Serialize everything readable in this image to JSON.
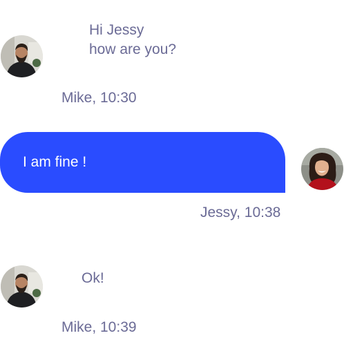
{
  "colors": {
    "accent": "#2a4cff",
    "text_muted": "#6b6b96",
    "bubble_text": "#ffffff"
  },
  "messages": [
    {
      "sender": "Mike",
      "direction": "incoming",
      "lines": [
        "Hi Jessy",
        "how are you?"
      ],
      "meta": "Mike, 10:30",
      "avatar_icon": "avatar-man-beard"
    },
    {
      "sender": "Jessy",
      "direction": "outgoing",
      "lines": [
        "I am fine !"
      ],
      "meta": "Jessy, 10:38",
      "avatar_icon": "avatar-woman-red-top"
    },
    {
      "sender": "Mike",
      "direction": "incoming",
      "lines": [
        "Ok!"
      ],
      "meta": "Mike, 10:39",
      "avatar_icon": "avatar-man-beard"
    }
  ]
}
